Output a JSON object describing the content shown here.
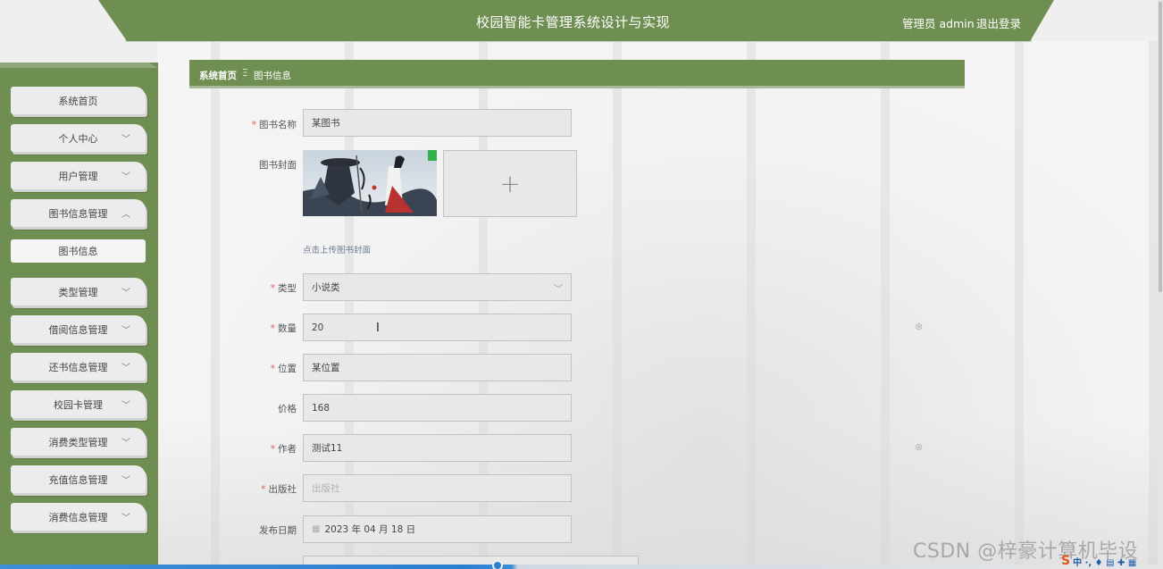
{
  "header": {
    "title": "校园智能卡管理系统设计与实现",
    "user": "管理员 admin",
    "logout": "退出登录"
  },
  "sidebar": {
    "items": [
      {
        "label": "系统首页",
        "chevron": ""
      },
      {
        "label": "个人中心",
        "chevron": "﹀"
      },
      {
        "label": "用户管理",
        "chevron": "﹀"
      },
      {
        "label": "图书信息管理",
        "chevron": "︿"
      },
      {
        "label": "图书信息",
        "chevron": ""
      },
      {
        "label": "类型管理",
        "chevron": "﹀"
      },
      {
        "label": "借阅信息管理",
        "chevron": "﹀"
      },
      {
        "label": "还书信息管理",
        "chevron": "﹀"
      },
      {
        "label": "校园卡管理",
        "chevron": "﹀"
      },
      {
        "label": "消费类型管理",
        "chevron": "﹀"
      },
      {
        "label": "充值信息管理",
        "chevron": "﹀"
      },
      {
        "label": "消费信息管理",
        "chevron": "﹀"
      }
    ]
  },
  "breadcrumb": {
    "home": "系统首页",
    "separator": "Ξ",
    "current": "图书信息"
  },
  "form": {
    "name_label": "图书名称",
    "name_value": "某图书",
    "cover_label": "图书封面",
    "cover_hint": "点击上传图书封面",
    "upload_plus": "+",
    "type_label": "类型",
    "type_value": "小说类",
    "type_caret": "﹀",
    "qty_label": "数量",
    "qty_value": "20",
    "location_label": "位置",
    "location_value": "某位置",
    "price_label": "价格",
    "price_value": "168",
    "author_label": "作者",
    "author_value": "测试11",
    "publisher_label": "出版社",
    "publisher_placeholder": "出版社",
    "date_label": "发布日期",
    "date_value": "2023 年 04 月 18 日",
    "required_mark": "*",
    "clear_icon": "⊗",
    "calendar_icon": "▦"
  },
  "overlay": {
    "watermark": "CSDN @梓豪计算机毕设",
    "ime_logo": "S",
    "ime_text": "中 ·, ♦ ▤ ✚ ▦"
  },
  "colors": {
    "primary_green": "#6f8f52",
    "required_red": "#e05b5b"
  }
}
